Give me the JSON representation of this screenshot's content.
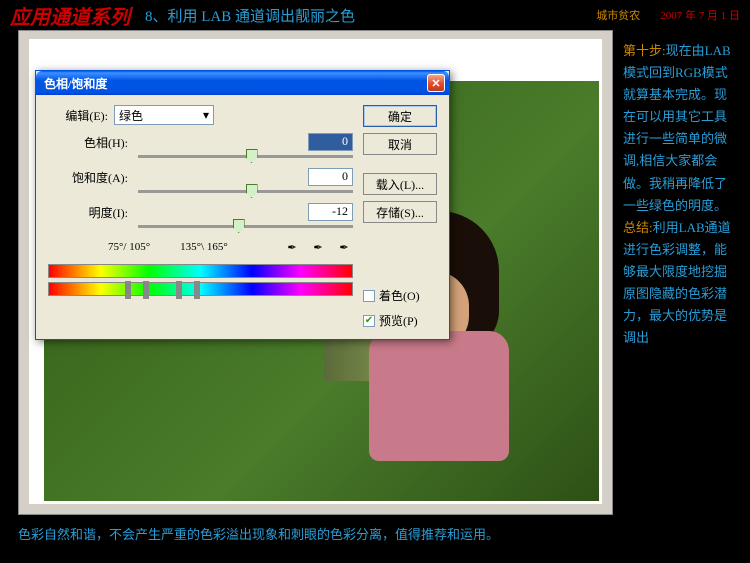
{
  "header": {
    "series": "应用通道系列",
    "title": "8、利用 LAB 通道调出靓丽之色",
    "author": "城市贫农",
    "date": "2007 年 7 月 1 日"
  },
  "dialog": {
    "title": "色相/饱和度",
    "edit_label": "编辑(E):",
    "edit_value": "绿色",
    "hue_label": "色相(H):",
    "hue_value": "0",
    "sat_label": "饱和度(A):",
    "sat_value": "0",
    "light_label": "明度(I):",
    "light_value": "-12",
    "range_left": "75°/ 105°",
    "range_right": "135°\\ 165°",
    "ok": "确定",
    "cancel": "取消",
    "load": "载入(L)...",
    "save": "存储(S)...",
    "colorize": "着色(O)",
    "preview": "预览(P)"
  },
  "sidebar": {
    "step_label": "第十步:",
    "step_text": "现在由LAB模式回到RGB模式就算基本完成。现在可以用其它工具进行一些简单的微调,相信大家都会做。我稍再降低了一些绿色的明度。",
    "summary_label": "总结:",
    "summary_text": "利用LAB通道进行色彩调整，能够最大限度地挖掘原图隐藏的色彩潜力，最大的优势是调出"
  },
  "footer": "色彩自然和谐，不会产生严重的色彩溢出现象和刺眼的色彩分离，值得推荐和运用。"
}
